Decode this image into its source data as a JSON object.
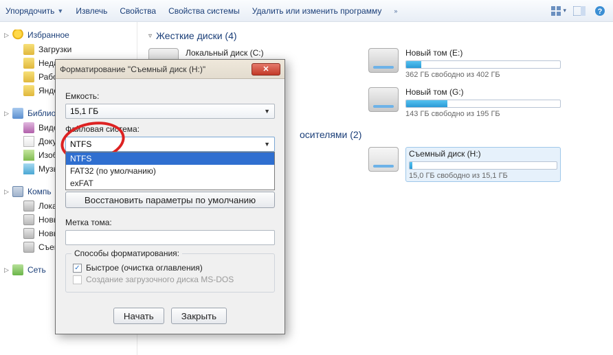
{
  "toolbar": {
    "organize": "Упорядочить",
    "extract": "Извлечь",
    "properties": "Свойства",
    "system_properties": "Свойства системы",
    "uninstall": "Удалить или изменить программу"
  },
  "sidebar": {
    "favorites": {
      "head": "Избранное",
      "items": [
        "Загрузки",
        "Недавн",
        "Рабоч",
        "Яндек"
      ]
    },
    "libraries": {
      "head": "Библио",
      "items": [
        "Видео",
        "Докум",
        "Изобр",
        "Музы"
      ]
    },
    "computer": {
      "head": "Компь",
      "items": [
        "Локал",
        "Новы",
        "Новы",
        "Съем"
      ]
    },
    "network": {
      "head": "Сеть"
    }
  },
  "content": {
    "hdd_head": "Жесткие диски (4)",
    "media_head": "осителями (2)",
    "disks": [
      {
        "name": "Локальный диск (C:)",
        "free": "",
        "fill_pct": 0
      },
      {
        "name": "Новый том (E:)",
        "free": "362 ГБ свободно из 402 ГБ",
        "fill_pct": 10
      },
      {
        "name": "Новый том (G:)",
        "free": "143 ГБ свободно из 195 ГБ",
        "fill_pct": 27
      }
    ],
    "removable": {
      "name": "Съемный диск (H:)",
      "free": "15,0 ГБ свободно из 15,1 ГБ",
      "fill_pct": 2
    }
  },
  "dialog": {
    "title": "Форматирование \"Съемный диск (H:)\"",
    "capacity_label": "Емкость:",
    "capacity_value": "15,1 ГБ",
    "fs_label": "Файловая система:",
    "fs_value": "NTFS",
    "fs_options": [
      "NTFS",
      "FAT32 (по умолчанию)",
      "exFAT"
    ],
    "restore_defaults": "Восстановить параметры по умолчанию",
    "label_label": "Метка тома:",
    "label_value": "",
    "group_legend": "Способы форматирования:",
    "quick": "Быстрое (очистка оглавления)",
    "msdos": "Создание загрузочного диска MS-DOS",
    "start": "Начать",
    "close_btn": "Закрыть"
  }
}
